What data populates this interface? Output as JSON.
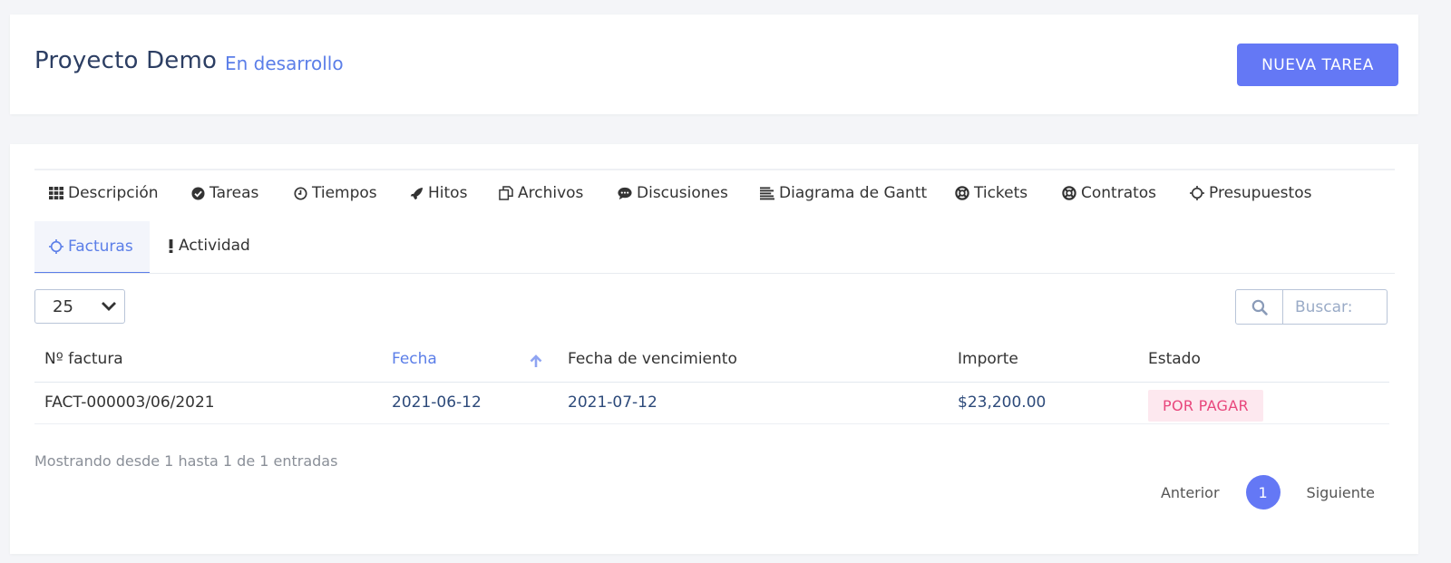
{
  "header": {
    "title": "Proyecto Demo",
    "status": "En desarrollo",
    "new_task_label": "NUEVA TAREA"
  },
  "tabs": {
    "descripcion": "Descripción",
    "tareas": "Tareas",
    "tiempos": "Tiempos",
    "hitos": "Hitos",
    "archivos": "Archivos",
    "discusiones": "Discusiones",
    "gantt": "Diagrama de Gantt",
    "tickets": "Tickets",
    "contratos": "Contratos",
    "presupuestos": "Presupuestos",
    "facturas": "Facturas",
    "actividad": "Actividad",
    "active": "Facturas"
  },
  "controls": {
    "page_size": "25",
    "search_placeholder": "Buscar:"
  },
  "table": {
    "columns": [
      "Nº factura",
      "Fecha",
      "Fecha de vencimiento",
      "Importe",
      "Estado"
    ],
    "sorted_column": "Fecha",
    "rows": [
      {
        "number": "FACT-000003/06/2021",
        "date": "2021-06-12",
        "due_date": "2021-07-12",
        "amount": "$23,200.00",
        "status": "POR PAGAR"
      }
    ]
  },
  "footer": {
    "info": "Mostrando desde 1 hasta 1 de 1 entradas",
    "prev": "Anterior",
    "current_page": "1",
    "next": "Siguiente"
  },
  "colors": {
    "accent": "#6478f5",
    "link": "#5b7ee8",
    "badge_bg": "#fde8ef",
    "badge_text": "#e8467c"
  }
}
